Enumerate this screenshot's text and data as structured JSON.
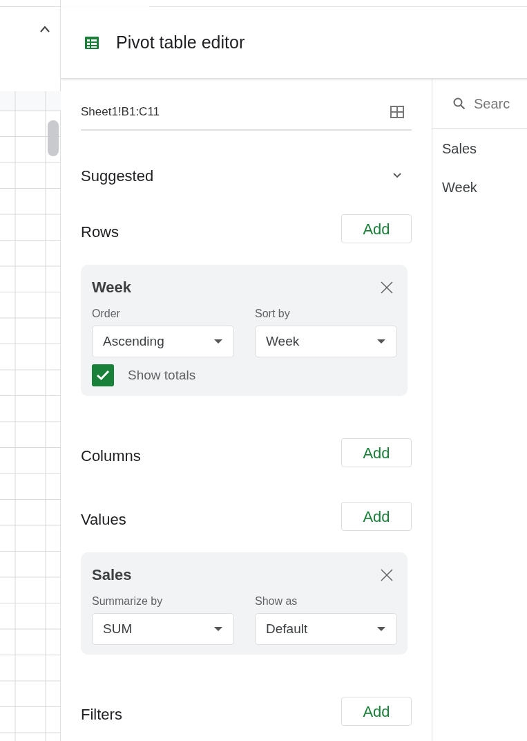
{
  "panel": {
    "title": "Pivot table editor"
  },
  "range": "Sheet1!B1:C11",
  "suggested": {
    "label": "Suggested",
    "expanded": false
  },
  "sections": [
    {
      "label": "Rows",
      "button": "Add",
      "cards": [
        {
          "title": "Week",
          "fields": [
            {
              "label": "Order",
              "value": "Ascending"
            },
            {
              "label": "Sort by",
              "value": "Week"
            }
          ],
          "checkbox": {
            "label": "Show totals",
            "checked": true
          }
        }
      ]
    },
    {
      "label": "Columns",
      "button": "Add"
    },
    {
      "label": "Values",
      "button": "Add",
      "cards": [
        {
          "title": "Sales",
          "fields": [
            {
              "label": "Summarize by",
              "value": "SUM"
            },
            {
              "label": "Show as",
              "value": "Default"
            }
          ]
        }
      ]
    },
    {
      "label": "Filters",
      "button": "Add"
    }
  ],
  "field_list": {
    "search_placeholder": "Searc",
    "items": [
      "Sales",
      "Week"
    ]
  }
}
